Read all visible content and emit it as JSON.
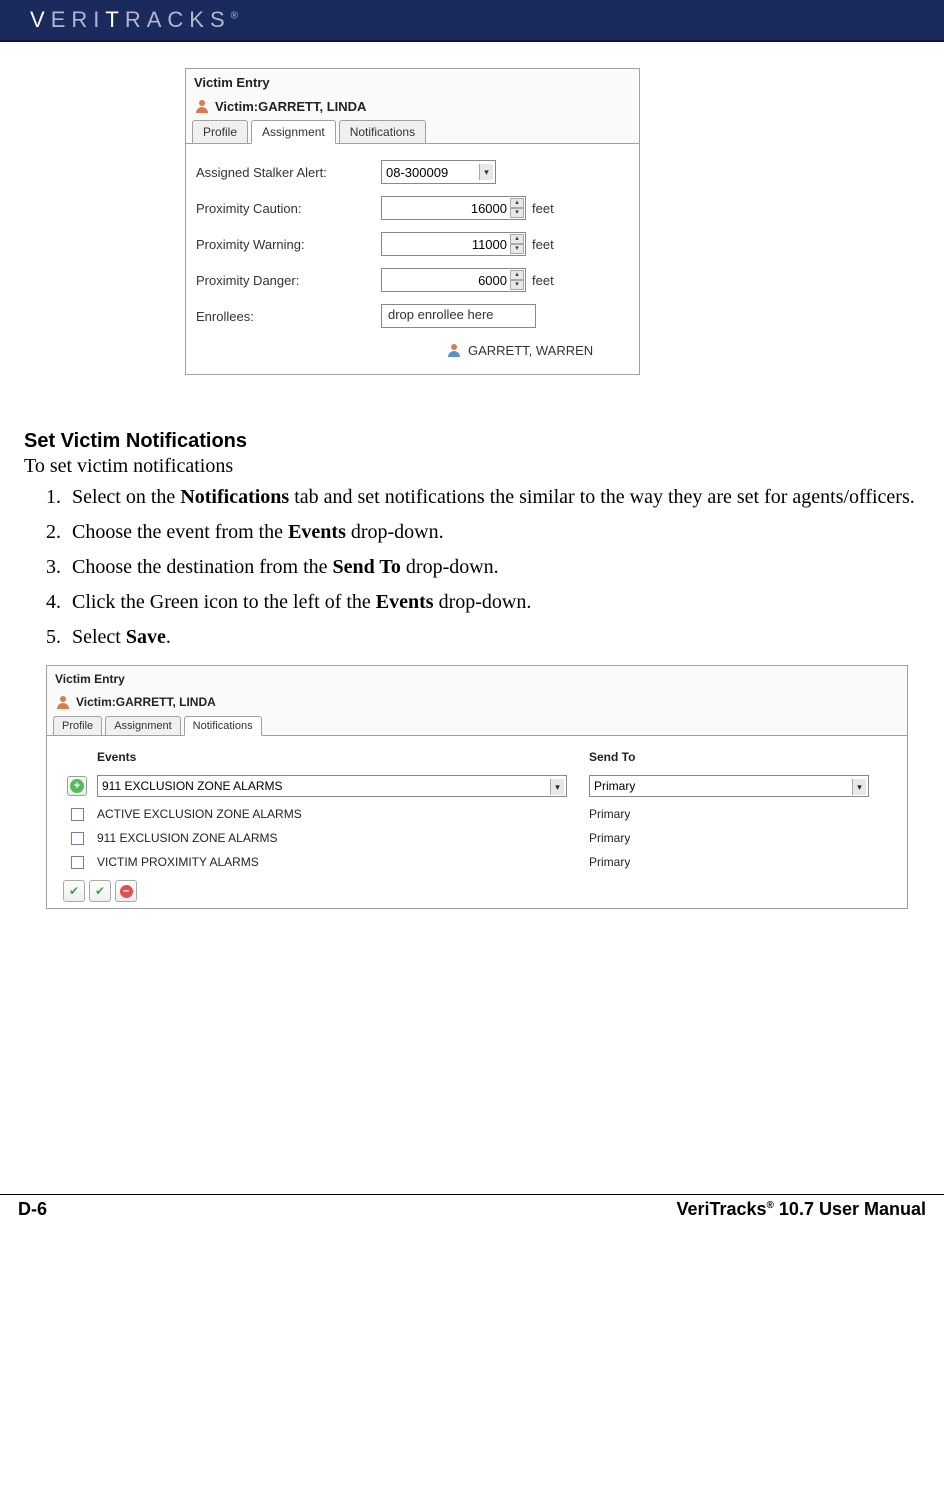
{
  "header": {
    "logo_html": "VERITRACKS",
    "reg": "®"
  },
  "panel1": {
    "title": "Victim Entry",
    "subhead_prefix": "Victim: ",
    "subhead_name": "GARRETT, LINDA",
    "tabs": [
      "Profile",
      "Assignment",
      "Notifications"
    ],
    "active_tab": 1,
    "fields": {
      "assigned_label": "Assigned Stalker Alert:",
      "assigned_value": "08-300009",
      "caution_label": "Proximity Caution:",
      "caution_value": "16000",
      "warning_label": "Proximity Warning:",
      "warning_value": "11000",
      "danger_label": "Proximity Danger:",
      "danger_value": "6000",
      "unit": "feet",
      "enrollees_label": "Enrollees:",
      "enrollees_placeholder": "drop enrollee here",
      "enrollee_name": "GARRETT, WARREN"
    }
  },
  "doc": {
    "heading": "Set Victim Notifications",
    "subline": "To set victim notifications",
    "steps": [
      {
        "pre": "Select on the ",
        "b": "Notifications",
        "post": " tab and set notifications the similar to the way they are set for agents/officers."
      },
      {
        "pre": "Choose the event from the ",
        "b": "Events",
        "post": " drop-down."
      },
      {
        "pre": "Choose the destination from the ",
        "b": "Send To",
        "post": " drop-down."
      },
      {
        "pre": "Click the Green icon to the left of the ",
        "b": "Events",
        "post": " drop-down."
      },
      {
        "pre": "Select ",
        "b": "Save",
        "post": "."
      }
    ]
  },
  "panel2": {
    "title": "Victim Entry",
    "subhead_prefix": "Victim: ",
    "subhead_name": "GARRETT, LINDA",
    "tabs": [
      "Profile",
      "Assignment",
      "Notifications"
    ],
    "active_tab": 2,
    "headers": {
      "events": "Events",
      "sendto": "Send To"
    },
    "new_row": {
      "event": "911 EXCLUSION ZONE ALARMS",
      "sendto": "Primary"
    },
    "rows": [
      {
        "event": "ACTIVE EXCLUSION ZONE ALARMS",
        "sendto": "Primary"
      },
      {
        "event": "911 EXCLUSION ZONE ALARMS",
        "sendto": "Primary"
      },
      {
        "event": "VICTIM PROXIMITY ALARMS",
        "sendto": "Primary"
      }
    ]
  },
  "footer": {
    "left": "D-6",
    "right_pre": "VeriTracks",
    "right_sup": "®",
    "right_post": " 10.7 User Manual"
  }
}
